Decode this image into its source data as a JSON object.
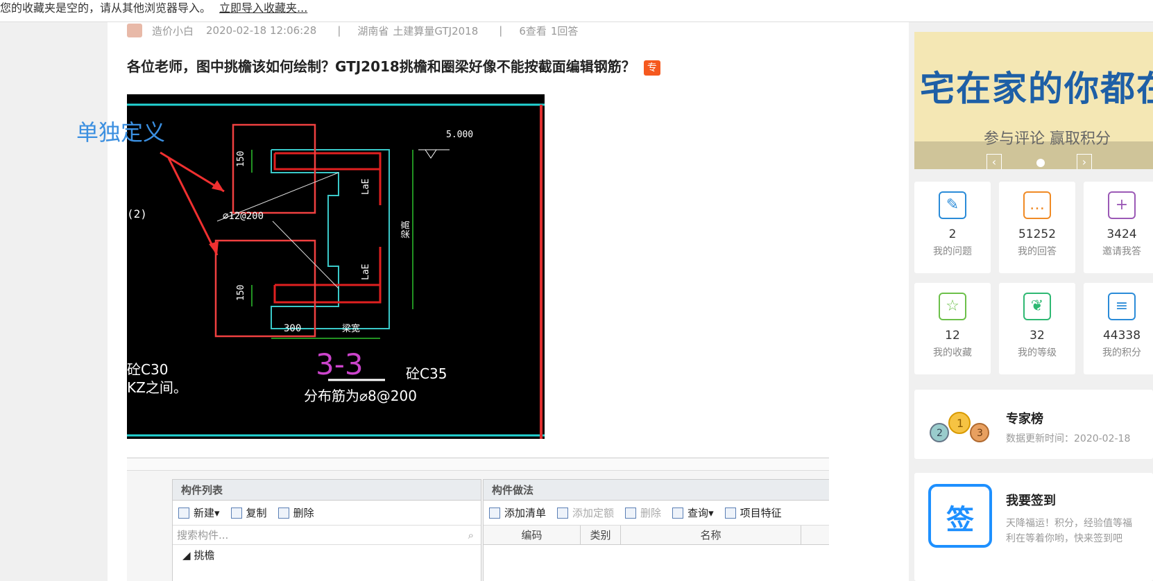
{
  "bookmarks": {
    "message": "您的收藏夹是空的，请从其他浏览器导入。",
    "import_link": "立即导入收藏夹..."
  },
  "post": {
    "author": "造价小白",
    "datetime": "2020-02-18 12:06:28",
    "region": "湖南省",
    "software": "土建算量GTJ2018",
    "views": "6查看",
    "answers": "1回答",
    "title": "各位老师，图中挑檐该如何绘制？GTJ2018挑檐和圈梁好像不能按截面编辑钢筋？",
    "tag": "专"
  },
  "annotation": {
    "label": "单独定义"
  },
  "cad": {
    "elev": "5.000",
    "rebar": "⌀12@200",
    "dim150a": "150",
    "dim150b": "150",
    "dim300": "300",
    "beam_width": "梁宽",
    "lae1": "LaE",
    "lae2": "LaE",
    "section": "3-3",
    "dist": "分布筋为⌀8@200",
    "conc_left": "砼C30",
    "kz": "KZ之间。",
    "conc_right": "砼C35",
    "left_ref": "(2)",
    "beam_h": "梁高"
  },
  "software": {
    "list_panel": "构件列表",
    "method_panel": "构件做法",
    "new_btn": "新建",
    "copy_btn": "复制",
    "delete_btn": "删除",
    "search_placeholder": "搜索构件...",
    "tree_root": "挑檐",
    "add_list": "添加清单",
    "add_quota": "添加定额",
    "delete2": "删除",
    "query": "查询",
    "item_feature": "项目特征",
    "col_code": "编码",
    "col_type": "类别",
    "col_name": "名称"
  },
  "sidebar": {
    "banner_title": "宅在家的你都在做什么",
    "banner_sub": "参与评论 赢取积分",
    "stats": [
      {
        "value": "2",
        "label": "我的问题",
        "icon": "edit-icon",
        "color": "#2a8bd8"
      },
      {
        "value": "51252",
        "label": "我的回答",
        "icon": "chat-icon",
        "color": "#f08a24"
      },
      {
        "value": "3424",
        "label": "邀请我答",
        "icon": "user-add-icon",
        "color": "#9b59b6"
      },
      {
        "value": "12",
        "label": "我的收藏",
        "icon": "star-icon",
        "color": "#6cc04a"
      },
      {
        "value": "32",
        "label": "我的等级",
        "icon": "leaf-icon",
        "color": "#2eb872"
      },
      {
        "value": "44338",
        "label": "我的积分",
        "icon": "coins-icon",
        "color": "#2a8bd8"
      }
    ],
    "experts_title": "专家榜",
    "experts_sub": "数据更新时间：2020-02-18",
    "signin_title": "我要签到",
    "signin_sub1": "天降福运！积分，经验值等福",
    "signin_sub2": "利在等着你哟，快来签到吧",
    "signin_icon": "签"
  }
}
